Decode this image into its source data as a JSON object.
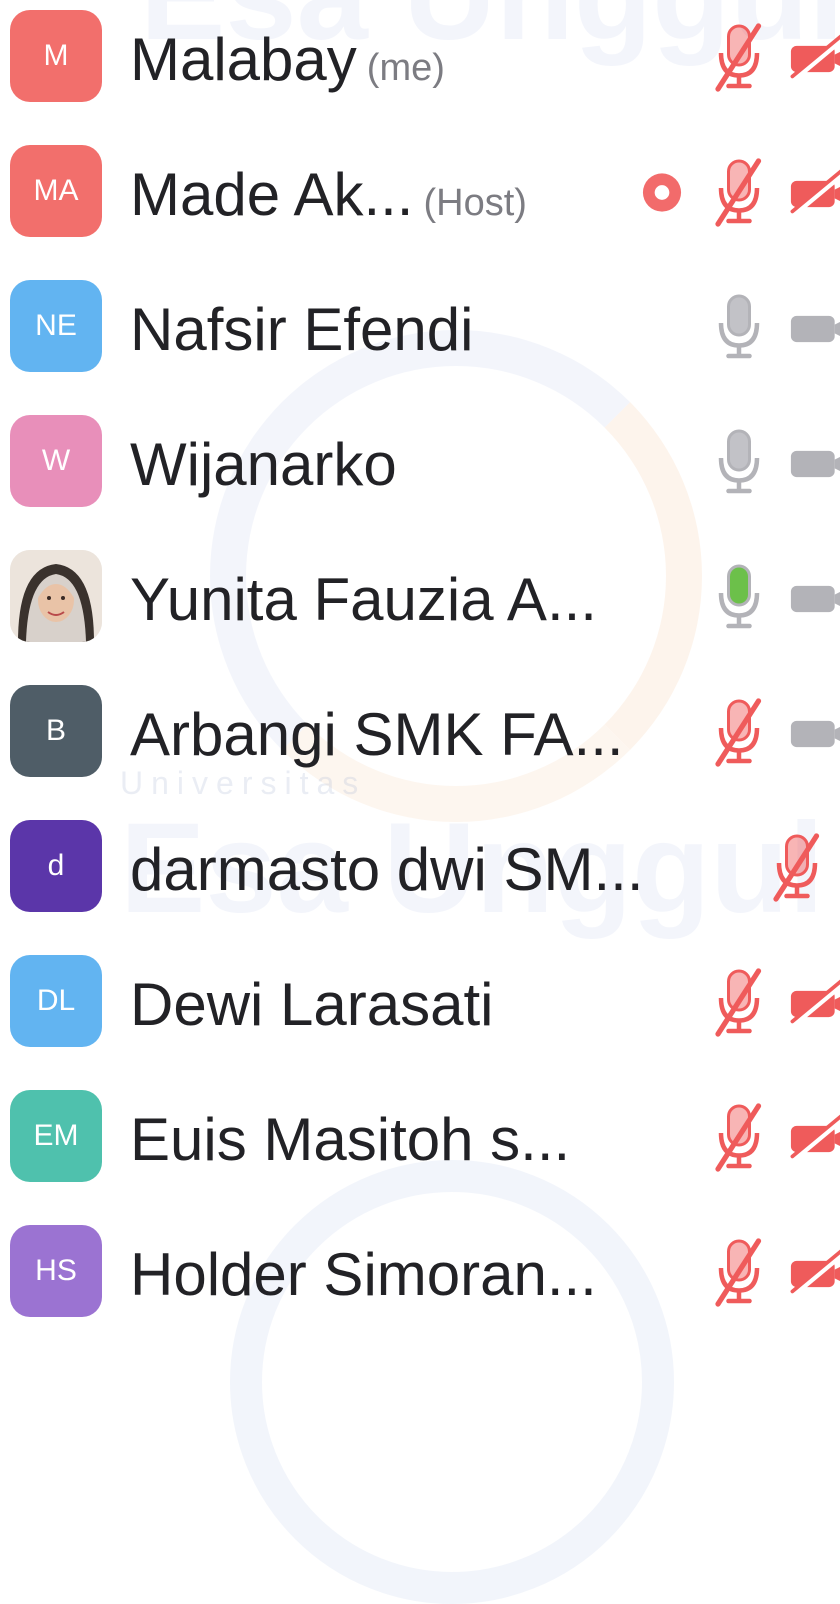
{
  "participants": [
    {
      "initials": "M",
      "name": "Malabay",
      "tag": "(me)",
      "avatar_color": "#f26f6c",
      "mic": "muted",
      "video": "off",
      "recording": false
    },
    {
      "initials": "MA",
      "name": "Made Ak...",
      "tag": "(Host)",
      "avatar_color": "#f26f6c",
      "mic": "muted",
      "video": "off",
      "recording": true
    },
    {
      "initials": "NE",
      "name": "Nafsir Efendi",
      "tag": "",
      "avatar_color": "#62b4f1",
      "mic": "on",
      "video": "on",
      "recording": false
    },
    {
      "initials": "W",
      "name": "Wijanarko",
      "tag": "",
      "avatar_color": "#e88fba",
      "mic": "on",
      "video": "on",
      "recording": false
    },
    {
      "initials": "",
      "name": "Yunita Fauzia A...",
      "tag": "",
      "avatar_color": "#ece6e2",
      "mic": "speaking",
      "video": "on",
      "recording": false
    },
    {
      "initials": "B",
      "name": "Arbangi SMK FA...",
      "tag": "",
      "avatar_color": "#4f5d67",
      "mic": "muted",
      "video": "on",
      "recording": false
    },
    {
      "initials": "d",
      "name": "darmasto dwi SM...",
      "tag": "",
      "avatar_color": "#5b36a9",
      "mic": "muted",
      "video": "none",
      "recording": false
    },
    {
      "initials": "DL",
      "name": "Dewi Larasati",
      "tag": "",
      "avatar_color": "#62b4f1",
      "mic": "muted",
      "video": "off",
      "recording": false
    },
    {
      "initials": "EM",
      "name": "Euis Masitoh s...",
      "tag": "",
      "avatar_color": "#4fc1ad",
      "mic": "muted",
      "video": "off",
      "recording": false
    },
    {
      "initials": "HS",
      "name": "Holder Simoran...",
      "tag": "",
      "avatar_color": "#9b73d2",
      "mic": "muted",
      "video": "off",
      "recording": false
    }
  ],
  "watermark": {
    "university": "Universitas",
    "name": "Esa Unggul"
  },
  "colors": {
    "muted": "#ef5b5b",
    "record": "#f26b6b",
    "icon_grey": "#b3b3b8",
    "speaking": "#6cc04a"
  }
}
